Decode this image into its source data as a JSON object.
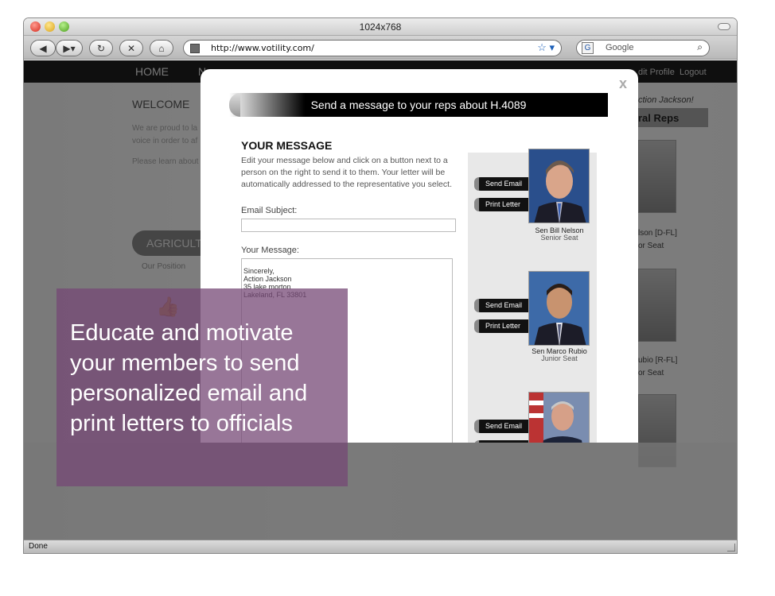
{
  "window": {
    "title": "1024x768",
    "url": "http://www.votility.com/",
    "search_placeholder": "Google",
    "status": "Done"
  },
  "site": {
    "nav_home": "HOME",
    "nav_n": "N",
    "nav_profile": "dit Profile",
    "nav_logout": "Logout",
    "welcome": "WELCOME",
    "bg_line1": "We are proud to la",
    "bg_line2": "voice in order to af",
    "bg_line3": "Please learn about",
    "agriculture": "AGRICULT",
    "our_position": "Our Position",
    "action_jackson": "ction Jackson!",
    "federal_reps": "ral Reps",
    "bg_rep1_name": "lson [D-FL]",
    "bg_rep1_seat": "or Seat",
    "bg_rep2_name": "ubio [R-FL]",
    "bg_rep2_seat": "or Seat"
  },
  "modal": {
    "close": "x",
    "header": "Send a message to your reps about H.4089",
    "section_title": "YOUR MESSAGE",
    "instructions": "Edit your message below and click on a button next to a person on the right to send it to them. Your letter will be automatically addressed to the representative you select.",
    "subject_label": "Email Subject:",
    "subject_value": "",
    "message_label": "Your Message:",
    "message_value": "Sincerely,\nAction Jackson\n35 lake morton\nLakeland, FL 33801",
    "send_email": "Send Email",
    "print_letter": "Print Letter",
    "reps": [
      {
        "name": "Sen Bill Nelson",
        "seat": "Senior Seat"
      },
      {
        "name": "Sen Marco Rubio",
        "seat": "Junior Seat"
      },
      {
        "name": "",
        "seat": ""
      }
    ]
  },
  "callout": {
    "text": "Educate and motivate your members to send personalized email and print letters to officials"
  },
  "colors": {
    "callout_bg": "#754875",
    "modal_header_bg": "#000000"
  }
}
